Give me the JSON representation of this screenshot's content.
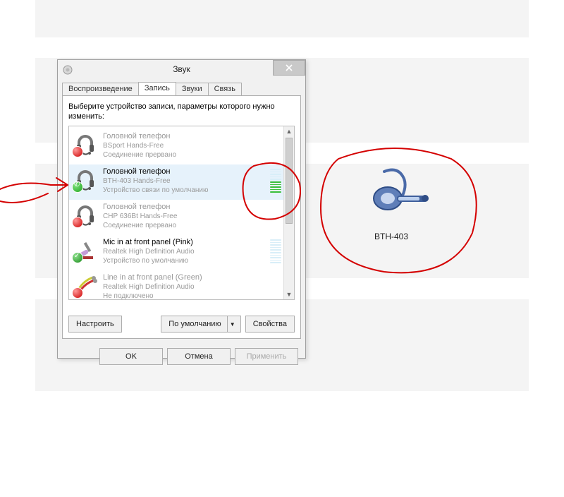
{
  "dialog": {
    "title": "Звук",
    "tabs": [
      "Воспроизведение",
      "Запись",
      "Звуки",
      "Связь"
    ],
    "active_tab_index": 1,
    "instruction": "Выберите устройство записи, параметры которого нужно изменить:",
    "configure_btn": "Настроить",
    "default_btn": "По умолчанию",
    "properties_btn": "Свойства",
    "ok_btn": "OK",
    "cancel_btn": "Отмена",
    "apply_btn": "Применить"
  },
  "devices": [
    {
      "name": "Головной телефон",
      "sub": "BSport Hands-Free",
      "status": "Соединение прервано",
      "dim": true,
      "badge": "red",
      "icon": "headset",
      "meter": false,
      "meter_on": 0
    },
    {
      "name": "Головной телефон",
      "sub": "BTH-403 Hands-Free",
      "status": "Устройство связи по умолчанию",
      "dim": false,
      "badge": "phone",
      "icon": "headset",
      "meter": true,
      "meter_on": 5,
      "selected": true
    },
    {
      "name": "Головной телефон",
      "sub": "CHP 636Bt Hands-Free",
      "status": "Соединение прервано",
      "dim": true,
      "badge": "red",
      "icon": "headset",
      "meter": false,
      "meter_on": 0
    },
    {
      "name": "Mic in at front panel (Pink)",
      "sub": "Realtek High Definition Audio",
      "status": "Устройство по умолчанию",
      "dim": false,
      "badge": "grn",
      "icon": "mic",
      "meter": true,
      "meter_on": 0
    },
    {
      "name": "Line in at front panel (Green)",
      "sub": "Realtek High Definition Audio",
      "status": "Не подключено",
      "dim": true,
      "badge": "red",
      "icon": "line",
      "meter": false,
      "meter_on": 0
    }
  ],
  "external": {
    "label": "BTH-403"
  }
}
